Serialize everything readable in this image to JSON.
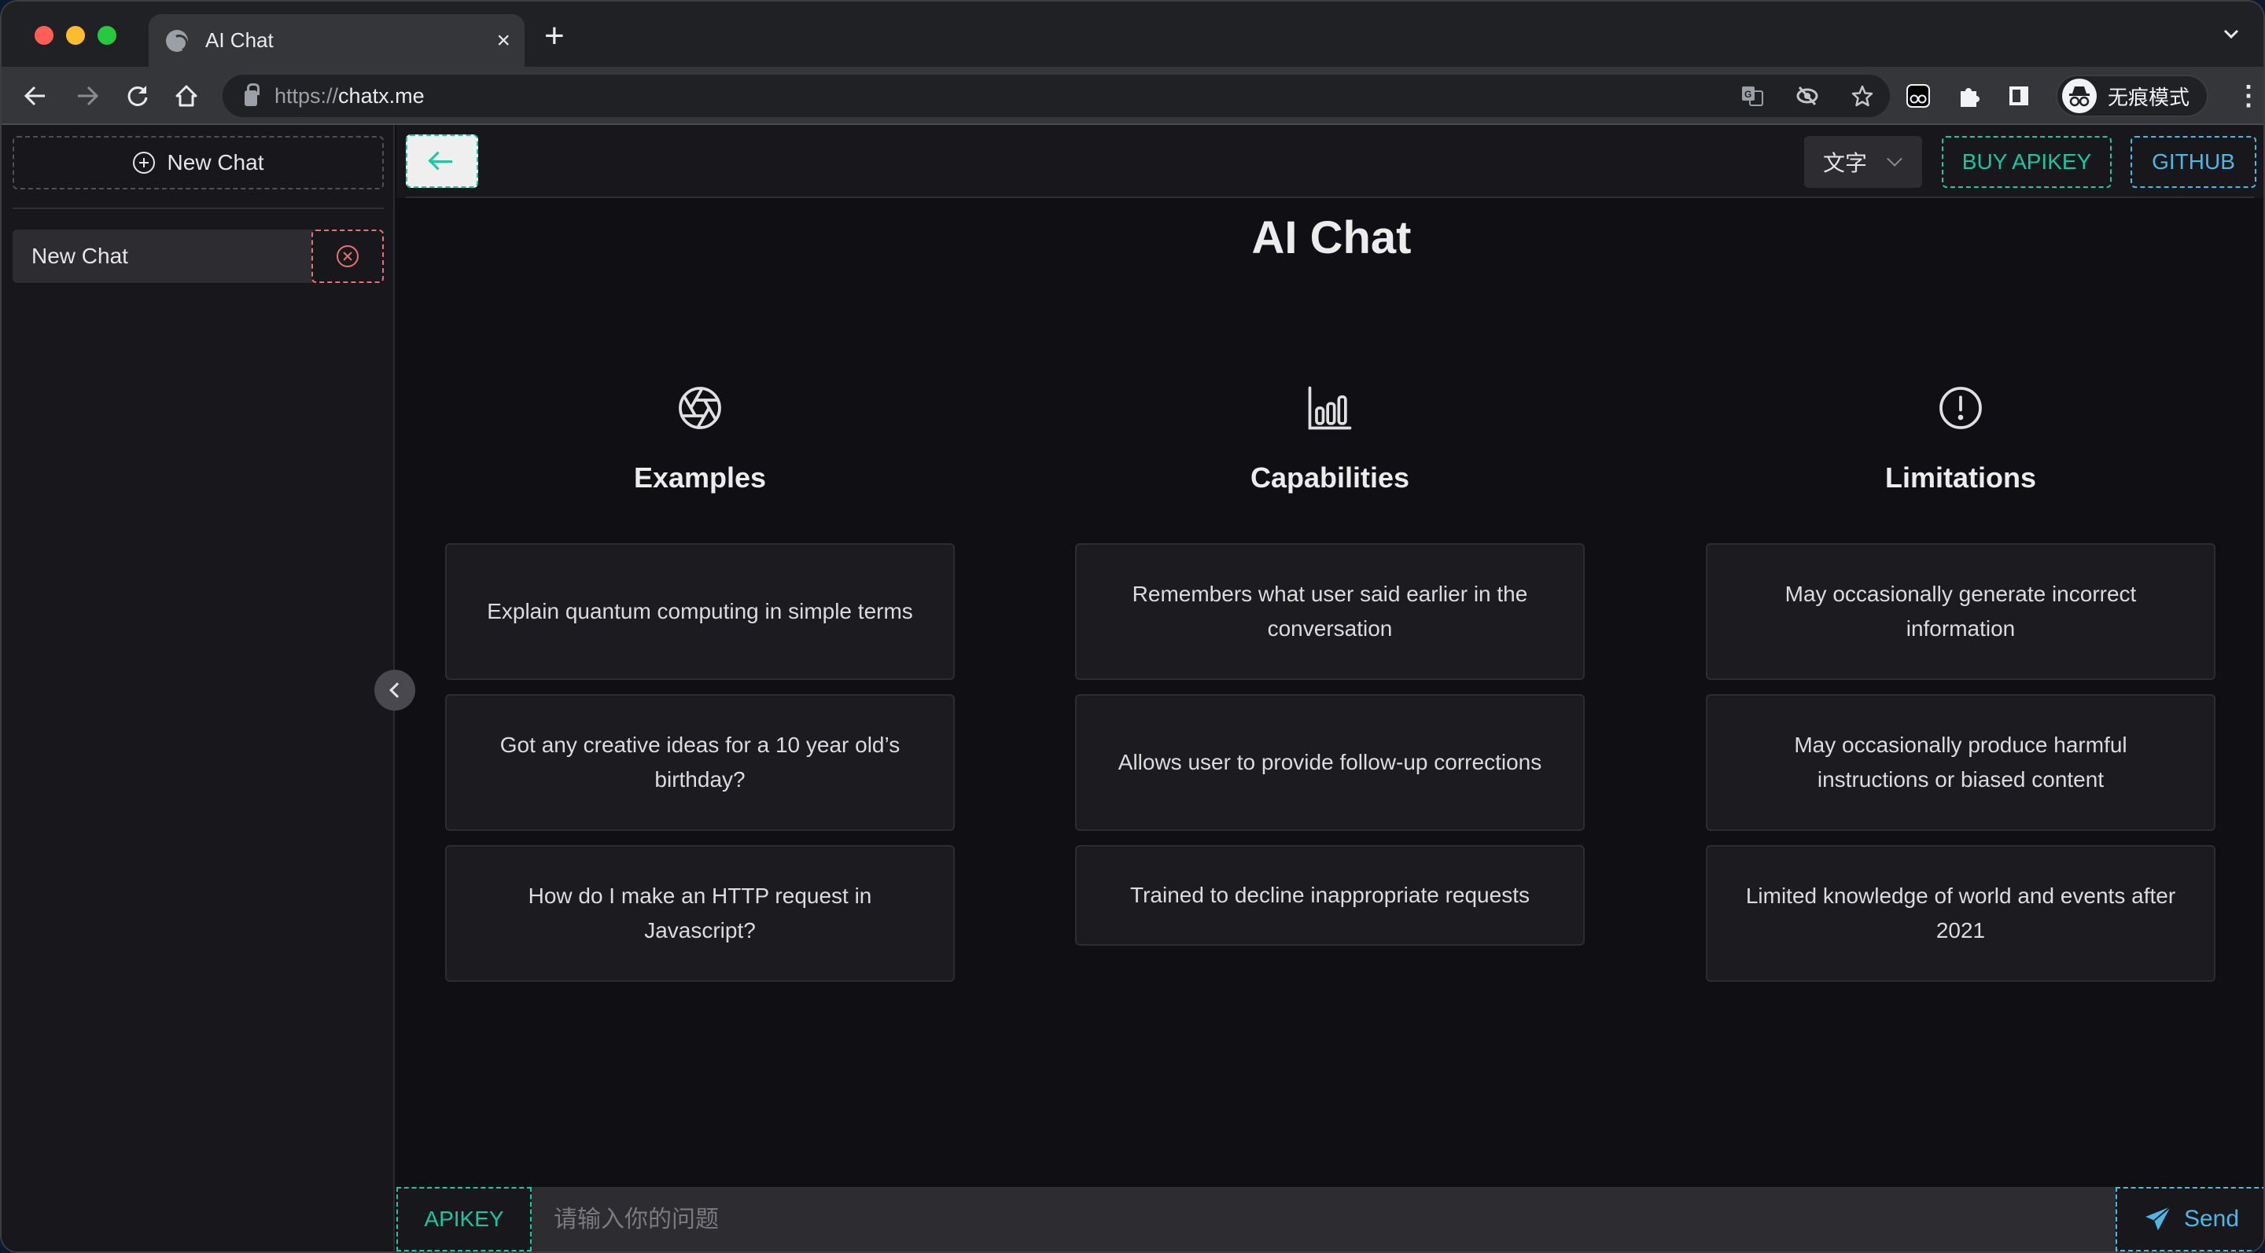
{
  "browser": {
    "tab": {
      "title": "AI Chat",
      "favicon": "globe-icon",
      "close": "×"
    },
    "new_tab": "+",
    "url": {
      "scheme": "https://",
      "host": "chatx.me"
    },
    "omnibox_icons": [
      "translate-icon",
      "eye-off-icon",
      "star-icon"
    ],
    "extensions": [
      "extension-glasses-icon",
      "puzzle-icon",
      "sidepanel-icon"
    ],
    "profile": {
      "label": "无痕模式",
      "icon": "incognito-icon"
    },
    "menu_icon": "⋮"
  },
  "sidebar": {
    "new_chat_label": "New Chat",
    "chats": [
      {
        "label": "New Chat"
      }
    ]
  },
  "header": {
    "language": "文字",
    "buy_label": "BUY APIKEY",
    "github_label": "GITHUB"
  },
  "main": {
    "title": "AI Chat",
    "columns": [
      {
        "heading": "Examples",
        "icon": "aperture-icon",
        "cards": [
          "Explain quantum computing in simple terms",
          "Got any creative ideas for a 10 year old’s birthday?",
          "How do I make an HTTP request in Javascript?"
        ]
      },
      {
        "heading": "Capabilities",
        "icon": "bar-chart-icon",
        "cards": [
          "Remembers what user said earlier in the conversation",
          "Allows user to provide follow-up corrections",
          "Trained to decline inappropriate requests"
        ]
      },
      {
        "heading": "Limitations",
        "icon": "alert-circle-icon",
        "cards": [
          "May occasionally generate incorrect information",
          "May occasionally produce harmful instructions or biased content",
          "Limited knowledge of world and events after 2021"
        ]
      }
    ]
  },
  "composer": {
    "apikey_label": "APIKEY",
    "placeholder": "请输入你的问题",
    "value": "",
    "send_label": "Send"
  },
  "colors": {
    "accent": "#18c8a0",
    "link_blue": "#4fb6e4",
    "danger": "#e57373",
    "page_bg": "#101014",
    "sidebar_bg": "#18181c"
  }
}
